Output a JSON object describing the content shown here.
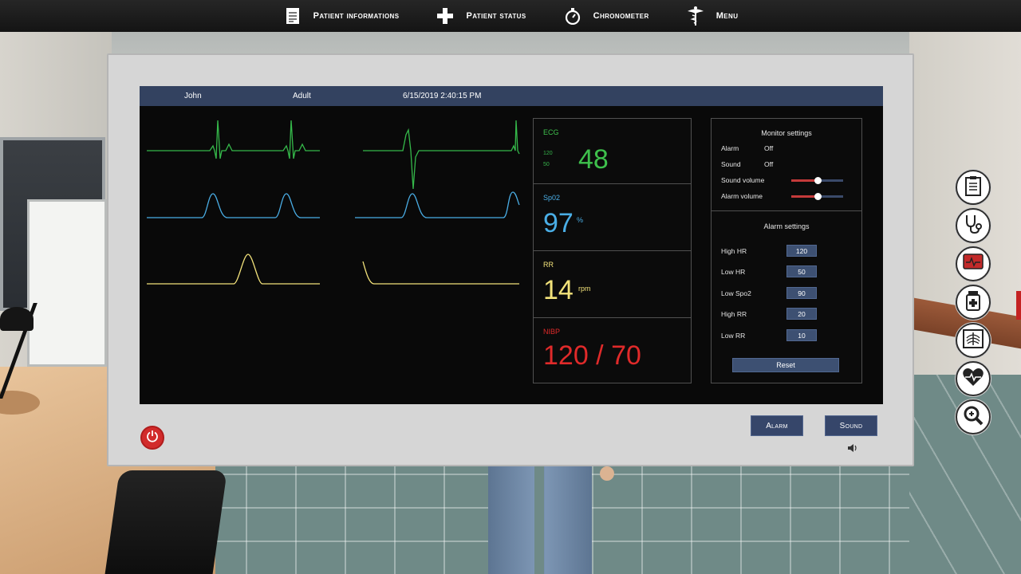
{
  "nav": {
    "items": [
      {
        "label": "Patient informations",
        "icon": "clipboard-document-icon"
      },
      {
        "label": "Patient status",
        "icon": "medical-cross-icon"
      },
      {
        "label": "Chronometer",
        "icon": "stopwatch-icon"
      },
      {
        "label": "Menu",
        "icon": "caduceus-icon"
      }
    ]
  },
  "monitor": {
    "header": {
      "name": "John",
      "age_group": "Adult",
      "datetime": "6/15/2019 2:40:15 PM"
    },
    "vitals": {
      "ecg": {
        "label": "ECG",
        "value": "48",
        "high_limit": "120",
        "low_limit": "50",
        "color": "#3ec04c"
      },
      "spo2": {
        "label": "Sp02",
        "value": "97",
        "unit": "%",
        "color": "#4aaee6"
      },
      "rr": {
        "label": "RR",
        "value": "14",
        "unit": "rpm",
        "color": "#f2e27a"
      },
      "nibp": {
        "label": "NIBP",
        "value": "120 / 70",
        "color": "#e02a2a"
      }
    },
    "monitor_settings": {
      "title": "Monitor settings",
      "alarm_label": "Alarm",
      "alarm_value": "Off",
      "sound_label": "Sound",
      "sound_value": "Off",
      "sound_volume_label": "Sound volume",
      "sound_volume": 0.5,
      "alarm_volume_label": "Alarm volume",
      "alarm_volume": 0.5
    },
    "alarm_settings": {
      "title": "Alarm settings",
      "rows": [
        {
          "label": "High HR",
          "value": "120"
        },
        {
          "label": "Low HR",
          "value": "50"
        },
        {
          "label": "Low Spo2",
          "value": "90"
        },
        {
          "label": "High RR",
          "value": "20"
        },
        {
          "label": "Low RR",
          "value": "10"
        }
      ],
      "reset_label": "Reset"
    },
    "buttons": {
      "alarm": "Alarm",
      "sound": "Sound"
    }
  },
  "tools": [
    {
      "icon": "clipboard-icon"
    },
    {
      "icon": "stethoscope-icon"
    },
    {
      "icon": "monitor-icon"
    },
    {
      "icon": "medicine-bottle-icon"
    },
    {
      "icon": "xray-icon"
    },
    {
      "icon": "heart-rate-icon"
    },
    {
      "icon": "magnifier-icon"
    }
  ],
  "colors": {
    "accent_blue": "#334260",
    "button_blue": "#36466a",
    "power_red": "#d22b2b"
  }
}
